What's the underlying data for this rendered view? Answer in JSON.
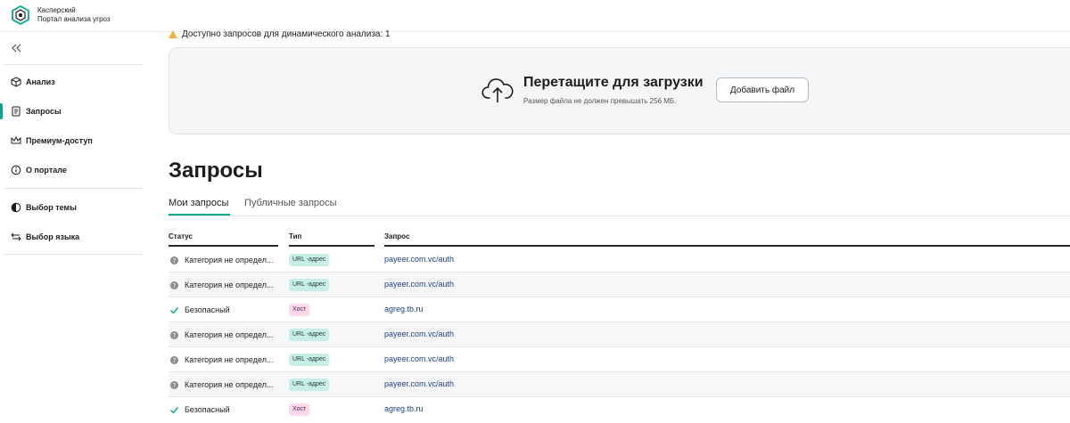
{
  "brand": {
    "line1": "Касперский",
    "line2": "Портал анализа угроз"
  },
  "sidebar": {
    "items": [
      {
        "label": "Анализ",
        "icon": "cube-icon"
      },
      {
        "label": "Запросы",
        "icon": "document-icon",
        "active": true
      },
      {
        "label": "Премиум-доступ",
        "icon": "crown-icon"
      },
      {
        "label": "О портале",
        "icon": "info-icon"
      }
    ],
    "settings": [
      {
        "label": "Выбор темы",
        "icon": "theme-icon"
      },
      {
        "label": "Выбор языка",
        "icon": "language-icon"
      }
    ]
  },
  "notice": {
    "text": "Доступно запросов для динамического анализа: 1"
  },
  "upload": {
    "title": "Перетащите для загрузки",
    "subtitle": "Размер файла не должен превышать 256 МБ.",
    "button": "Добавить файл"
  },
  "page_title": "Запросы",
  "tabs": [
    {
      "label": "Мои запросы",
      "active": true
    },
    {
      "label": "Публичные запросы",
      "active": false
    }
  ],
  "table": {
    "headers": [
      "Статус",
      "Тип",
      "Запрос"
    ],
    "rows": [
      {
        "status": "Категория не определ...",
        "status_kind": "unknown",
        "type": "URL -адрес",
        "type_kind": "url",
        "request": "payeer.com.vc/auth"
      },
      {
        "status": "Категория не определ...",
        "status_kind": "unknown",
        "type": "URL -адрес",
        "type_kind": "url",
        "request": "payeer.com.vc/auth"
      },
      {
        "status": "Безопасный",
        "status_kind": "safe",
        "type": "Хост",
        "type_kind": "host",
        "request": "agreg.tb.ru"
      },
      {
        "status": "Категория не определ...",
        "status_kind": "unknown",
        "type": "URL -адрес",
        "type_kind": "url",
        "request": "payeer.com.vc/auth"
      },
      {
        "status": "Категория не определ...",
        "status_kind": "unknown",
        "type": "URL -адрес",
        "type_kind": "url",
        "request": "payeer.com.vc/auth"
      },
      {
        "status": "Категория не определ...",
        "status_kind": "unknown",
        "type": "URL -адрес",
        "type_kind": "url",
        "request": "payeer.com.vc/auth"
      },
      {
        "status": "Безопасный",
        "status_kind": "safe",
        "type": "Хост",
        "type_kind": "host",
        "request": "agreg.tb.ru"
      }
    ]
  },
  "colors": {
    "accent": "#00a88e",
    "link": "#1f3f8c",
    "url_badge": "#c8efe6",
    "host_badge": "#fcd8ec"
  }
}
